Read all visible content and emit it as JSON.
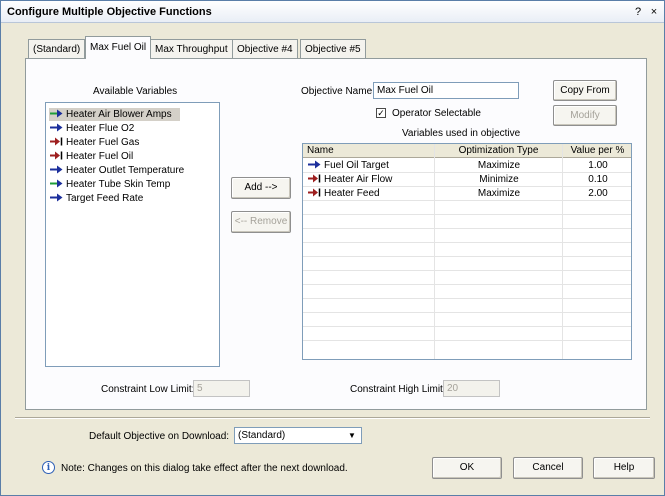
{
  "window": {
    "title": "Configure Multiple Objective Functions",
    "help_glyph": "?",
    "close_glyph": "×"
  },
  "tabs": [
    {
      "label": "(Standard)"
    },
    {
      "label": "Max Fuel Oil"
    },
    {
      "label": "Max Throughput"
    },
    {
      "label": "Objective #4"
    },
    {
      "label": "Objective #5"
    }
  ],
  "available": {
    "title": "Available Variables",
    "items": [
      {
        "label": "Heater Air Blower Amps",
        "icon": "arrow-right-icon"
      },
      {
        "label": "Heater Flue O2",
        "icon": "arrow-right-icon"
      },
      {
        "label": "Heater Fuel Gas",
        "icon": "arrow-bar-icon"
      },
      {
        "label": "Heater Fuel Oil",
        "icon": "arrow-bar-icon"
      },
      {
        "label": "Heater Outlet Temperature",
        "icon": "arrow-right-icon"
      },
      {
        "label": "Heater Tube Skin Temp",
        "icon": "arrow-right-icon"
      },
      {
        "label": "Target Feed Rate",
        "icon": "arrow-right-icon"
      }
    ]
  },
  "buttons": {
    "add": "Add -->",
    "remove": "<-- Remove",
    "copy_from": "Copy From",
    "modify": "Modify",
    "ok": "OK",
    "cancel": "Cancel",
    "help": "Help"
  },
  "objective": {
    "name_label": "Objective Name",
    "name_value": "Max Fuel Oil",
    "operator_label": "Operator Selectable",
    "operator_checked": "✓",
    "used_title": "Variables used in objective"
  },
  "grid": {
    "columns": [
      "Name",
      "Optimization Type",
      "Value per %"
    ],
    "rows": [
      {
        "name": "Fuel Oil Target",
        "type": "Maximize",
        "value": "1.00",
        "icon": "arrow-right-icon"
      },
      {
        "name": "Heater Air Flow",
        "type": "Minimize",
        "value": "0.10",
        "icon": "arrow-bar-icon"
      },
      {
        "name": "Heater Feed",
        "type": "Maximize",
        "value": "2.00",
        "icon": "arrow-bar-icon"
      }
    ]
  },
  "limits": {
    "low_label": "Constraint Low Limit:",
    "low_value": "5",
    "high_label": "Constraint High Limit:",
    "high_value": "20"
  },
  "footer": {
    "default_label": "Default Objective on Download:",
    "default_value": "(Standard)",
    "note": "Note: Changes on this dialog take effect after the next download."
  },
  "colors": {
    "arrow_green": "#1f9e3a",
    "arrow_blue": "#1c2f9c",
    "arrow_red": "#9e1f1f"
  }
}
